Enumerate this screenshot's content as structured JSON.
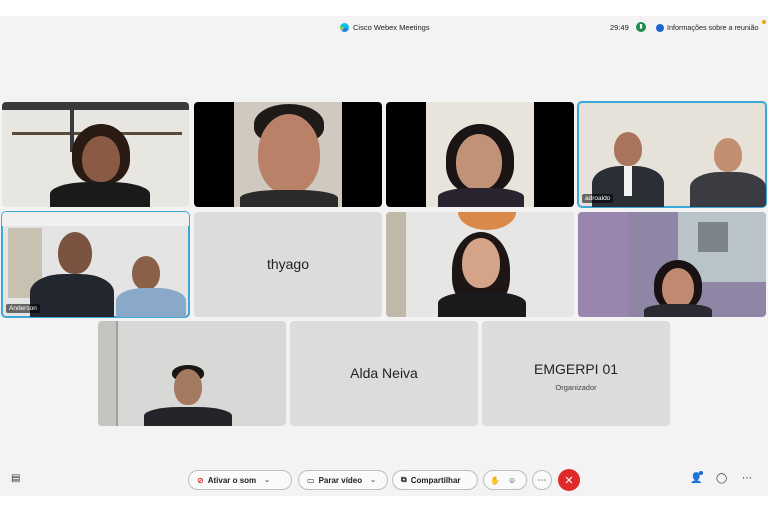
{
  "titlebar": {
    "app_title": "Cisco Webex Meetings",
    "timer": "29:49",
    "network_icon": "signal-icon",
    "info_label": "Informações sobre a reunião"
  },
  "participants": [
    {
      "name": "",
      "label_visible": false
    },
    {
      "name": "",
      "label_visible": false
    },
    {
      "name": "",
      "label_visible": false
    },
    {
      "name": "adroaldo",
      "label_visible": true,
      "active_speaker": true
    },
    {
      "name": "Anderson",
      "label_visible": true,
      "active_speaker": true
    },
    {
      "name": "thyago",
      "video_off": true
    },
    {
      "name": "",
      "label_visible": false
    },
    {
      "name": "",
      "label_visible": false
    },
    {
      "name": "",
      "label_visible": false
    },
    {
      "name": "Alda Neiva",
      "video_off": true
    },
    {
      "name": "EMGERPI 01",
      "role": "Organizador",
      "video_off": true
    }
  ],
  "toolbar": {
    "mute_label": "Ativar o som",
    "video_label": "Parar vídeo",
    "share_label": "Compartilhar",
    "icons": [
      "chat-icon",
      "mic-muted-icon",
      "video-icon",
      "share-icon",
      "raise-hand-icon",
      "reactions-icon",
      "more-icon",
      "end-call-icon",
      "participants-icon",
      "chat-bubble-icon",
      "overflow-icon"
    ]
  },
  "colors": {
    "active_speaker_border": "#3ba8d8",
    "end_call": "#e02a2a",
    "tile_placeholder": "#dcdcdc",
    "background": "#f3f3f3"
  }
}
